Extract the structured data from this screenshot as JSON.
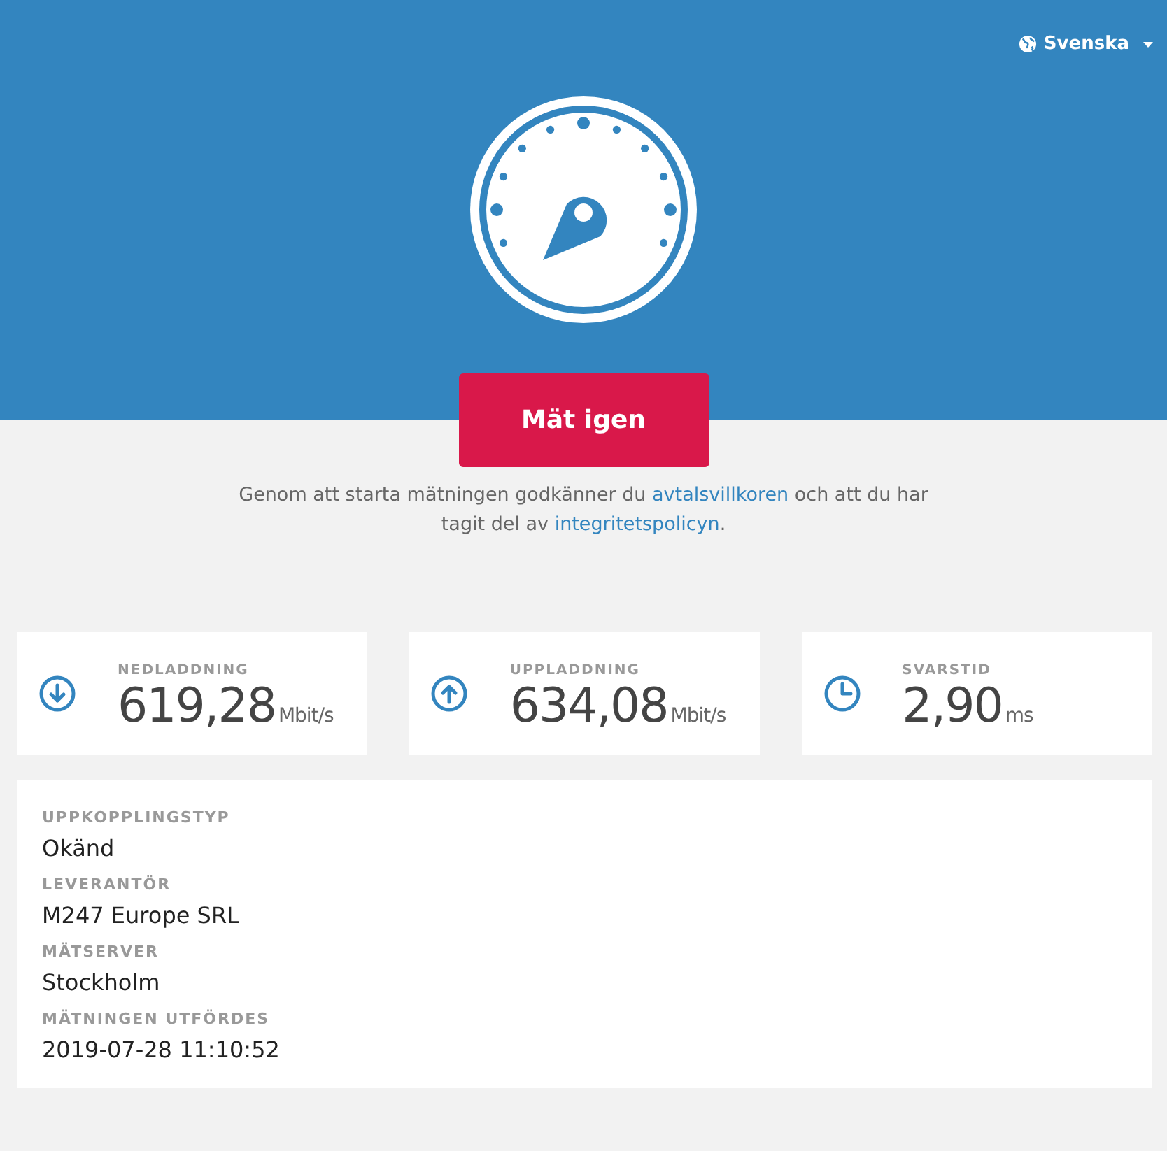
{
  "language": {
    "label": "Svenska"
  },
  "button": {
    "label": "Mät igen"
  },
  "consent": [
    {
      "kind": "text",
      "text": "Genom att starta mätningen godkänner du "
    },
    {
      "kind": "link",
      "text": "avtalsvillkoren"
    },
    {
      "kind": "text",
      "text": " och att du har tagit del av "
    },
    {
      "kind": "link",
      "text": "integritetspolicyn"
    },
    {
      "kind": "text",
      "text": "."
    }
  ],
  "results": [
    {
      "kind": "download",
      "label": "NEDLADDNING",
      "value": "619,28",
      "unit": "Mbit/s"
    },
    {
      "kind": "upload",
      "label": "UPPLADDNING",
      "value": "634,08",
      "unit": "Mbit/s"
    },
    {
      "kind": "latency",
      "label": "SVARSTID",
      "value": "2,90",
      "unit": "ms"
    }
  ],
  "details": [
    {
      "label": "UPPKOPPLINGSTYP",
      "value": "Okänd"
    },
    {
      "label": "LEVERANTÖR",
      "value": "M247 Europe SRL"
    },
    {
      "label": "MÄTSERVER",
      "value": "Stockholm"
    },
    {
      "label": "MÄTNINGEN UTFÖRDES",
      "value": "2019-07-28 11:10:52"
    }
  ]
}
